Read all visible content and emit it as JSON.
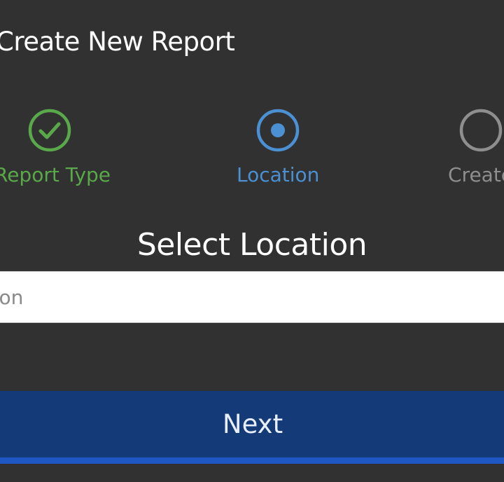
{
  "header": {
    "title": "Create New Report"
  },
  "steps": [
    {
      "label": "Report Type",
      "state": "complete",
      "icon": "check-circle-icon",
      "color": "#59a84a"
    },
    {
      "label": "Location",
      "state": "active",
      "icon": "radio-dot-icon",
      "color": "#4a90d2"
    },
    {
      "label": "Create",
      "state": "pending",
      "icon": "empty-circle-icon",
      "color": "#8e8e8e"
    }
  ],
  "form": {
    "section_title": "Select Location",
    "location_placeholder": "Location",
    "next_label": "Next"
  },
  "colors": {
    "background": "#313131",
    "button": "#143a78",
    "button_accent": "#1f58c4"
  }
}
